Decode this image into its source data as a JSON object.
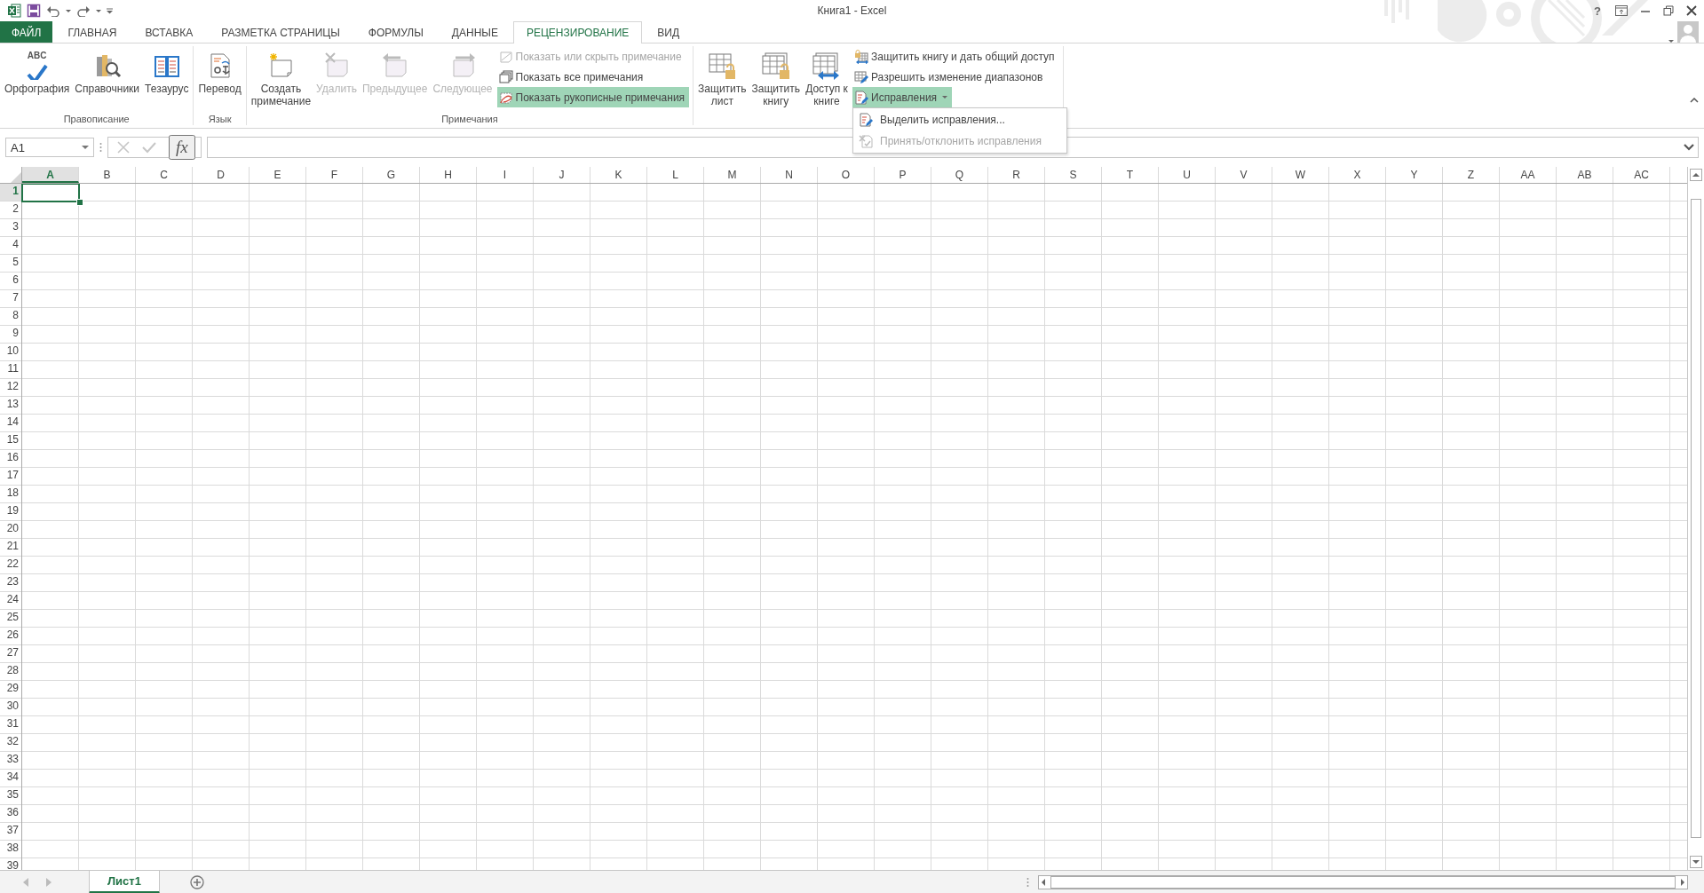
{
  "window": {
    "title": "Книга1 - Excel",
    "help": "?"
  },
  "tabs": [
    {
      "label": "ФАЙЛ",
      "kind": "file",
      "selected": false
    },
    {
      "label": "ГЛАВНАЯ",
      "kind": "tab",
      "selected": false
    },
    {
      "label": "ВСТАВКА",
      "kind": "tab",
      "selected": false
    },
    {
      "label": "РАЗМЕТКА СТРАНИЦЫ",
      "kind": "tab",
      "selected": false
    },
    {
      "label": "ФОРМУЛЫ",
      "kind": "tab",
      "selected": false
    },
    {
      "label": "ДАННЫЕ",
      "kind": "tab",
      "selected": false
    },
    {
      "label": "РЕЦЕНЗИРОВАНИЕ",
      "kind": "tab",
      "selected": true
    },
    {
      "label": "ВИД",
      "kind": "tab",
      "selected": false
    }
  ],
  "ribbon": {
    "groups": [
      {
        "label": "Правописание",
        "items": [
          {
            "kind": "large",
            "label": "Орфография",
            "icon_text": "ABC",
            "disabled": false
          },
          {
            "kind": "large",
            "label": "Справочники",
            "disabled": false
          },
          {
            "kind": "large",
            "label": "Тезаурус",
            "disabled": false
          }
        ]
      },
      {
        "label": "Язык",
        "items": [
          {
            "kind": "large",
            "label": "Перевод",
            "disabled": false
          }
        ]
      },
      {
        "label": "Примечания",
        "items": [
          {
            "kind": "large",
            "label": "Создать примечание",
            "disabled": false
          },
          {
            "kind": "large",
            "label": "Удалить",
            "disabled": true
          },
          {
            "kind": "large",
            "label": "Предыдущее",
            "disabled": true
          },
          {
            "kind": "large",
            "label": "Следующее",
            "disabled": true
          },
          {
            "kind": "stack",
            "items": [
              {
                "kind": "button",
                "label": "Показать или скрыть примечание",
                "disabled": true,
                "on": false
              },
              {
                "kind": "button",
                "label": "Показать все примечания",
                "disabled": false,
                "on": false
              },
              {
                "kind": "button",
                "label": "Показать рукописные примечания",
                "disabled": false,
                "on": true
              }
            ]
          }
        ]
      },
      {
        "items": [
          {
            "kind": "large",
            "label": "Защитить лист",
            "disabled": false
          },
          {
            "kind": "large",
            "label": "Защитить книгу",
            "disabled": false
          },
          {
            "kind": "large",
            "label": "Доступ к книге",
            "disabled": false
          },
          {
            "kind": "stack",
            "items": [
              {
                "kind": "button",
                "label": "Защитить книгу и дать общий доступ",
                "disabled": false,
                "on": false
              },
              {
                "kind": "button",
                "label": "Разрешить изменение диапазонов",
                "disabled": false,
                "on": false
              },
              {
                "kind": "dropdown",
                "label": "Исправления",
                "disabled": false,
                "on": true,
                "menu": [
                  {
                    "label": "Выделить исправления...",
                    "disabled": false
                  },
                  {
                    "label": "Принять/отклонить исправления",
                    "disabled": true
                  }
                ]
              }
            ]
          }
        ]
      }
    ]
  },
  "formula_bar": {
    "name_box": "A1",
    "function_label": "fx"
  },
  "sheet": {
    "columns": [
      {
        "label": "A",
        "selected": true
      },
      {
        "label": "B",
        "selected": false
      },
      {
        "label": "C",
        "selected": false
      },
      {
        "label": "D",
        "selected": false
      },
      {
        "label": "E",
        "selected": false
      },
      {
        "label": "F",
        "selected": false
      },
      {
        "label": "G",
        "selected": false
      },
      {
        "label": "H",
        "selected": false
      },
      {
        "label": "I",
        "selected": false
      },
      {
        "label": "J",
        "selected": false
      },
      {
        "label": "K",
        "selected": false
      },
      {
        "label": "L",
        "selected": false
      },
      {
        "label": "M",
        "selected": false
      },
      {
        "label": "N",
        "selected": false
      },
      {
        "label": "O",
        "selected": false
      },
      {
        "label": "P",
        "selected": false
      },
      {
        "label": "Q",
        "selected": false
      },
      {
        "label": "R",
        "selected": false
      },
      {
        "label": "S",
        "selected": false
      },
      {
        "label": "T",
        "selected": false
      },
      {
        "label": "U",
        "selected": false
      },
      {
        "label": "V",
        "selected": false
      },
      {
        "label": "W",
        "selected": false
      },
      {
        "label": "X",
        "selected": false
      },
      {
        "label": "Y",
        "selected": false
      },
      {
        "label": "Z",
        "selected": false
      },
      {
        "label": "AA",
        "selected": false
      },
      {
        "label": "AB",
        "selected": false
      },
      {
        "label": "AC",
        "selected": false
      }
    ],
    "rows": [
      {
        "label": "1",
        "selected": true
      },
      {
        "label": "2",
        "selected": false
      },
      {
        "label": "3",
        "selected": false
      },
      {
        "label": "4",
        "selected": false
      },
      {
        "label": "5",
        "selected": false
      },
      {
        "label": "6",
        "selected": false
      },
      {
        "label": "7",
        "selected": false
      },
      {
        "label": "8",
        "selected": false
      },
      {
        "label": "9",
        "selected": false
      },
      {
        "label": "10",
        "selected": false
      },
      {
        "label": "11",
        "selected": false
      },
      {
        "label": "12",
        "selected": false
      },
      {
        "label": "13",
        "selected": false
      },
      {
        "label": "14",
        "selected": false
      },
      {
        "label": "15",
        "selected": false
      },
      {
        "label": "16",
        "selected": false
      },
      {
        "label": "17",
        "selected": false
      },
      {
        "label": "18",
        "selected": false
      },
      {
        "label": "19",
        "selected": false
      },
      {
        "label": "20",
        "selected": false
      },
      {
        "label": "21",
        "selected": false
      },
      {
        "label": "22",
        "selected": false
      },
      {
        "label": "23",
        "selected": false
      },
      {
        "label": "24",
        "selected": false
      },
      {
        "label": "25",
        "selected": false
      },
      {
        "label": "26",
        "selected": false
      },
      {
        "label": "27",
        "selected": false
      },
      {
        "label": "28",
        "selected": false
      },
      {
        "label": "29",
        "selected": false
      },
      {
        "label": "30",
        "selected": false
      },
      {
        "label": "31",
        "selected": false
      },
      {
        "label": "32",
        "selected": false
      },
      {
        "label": "33",
        "selected": false
      },
      {
        "label": "34",
        "selected": false
      },
      {
        "label": "35",
        "selected": false
      },
      {
        "label": "36",
        "selected": false
      },
      {
        "label": "37",
        "selected": false
      },
      {
        "label": "38",
        "selected": false
      },
      {
        "label": "39",
        "selected": false
      }
    ]
  },
  "sheet_tabs": [
    {
      "label": "Лист1",
      "selected": true
    }
  ]
}
